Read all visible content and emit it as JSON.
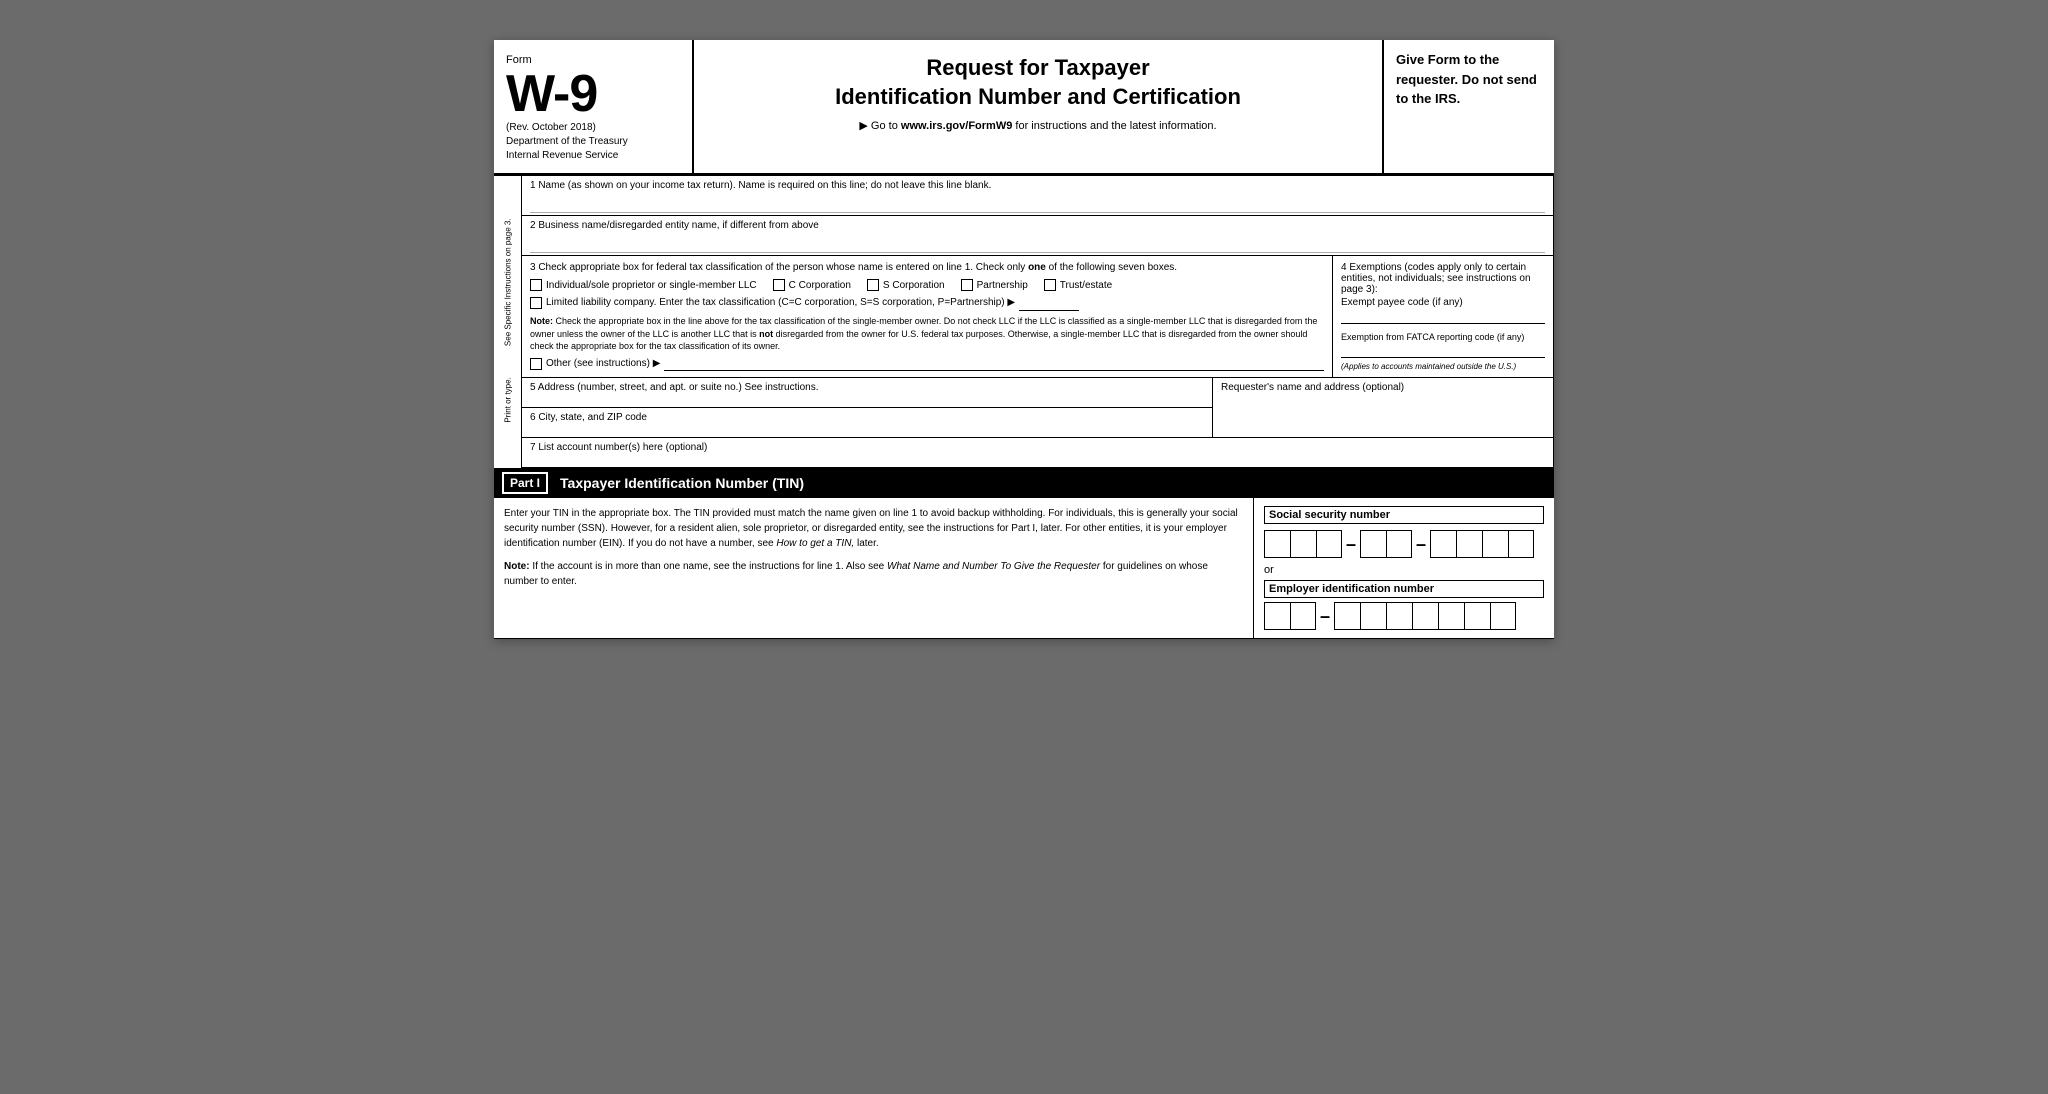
{
  "header": {
    "form_label": "Form",
    "form_number": "W-9",
    "rev": "(Rev. October 2018)",
    "dept1": "Department of the Treasury",
    "dept2": "Internal Revenue Service",
    "title_line1": "Request for Taxpayer",
    "title_line2": "Identification Number and Certification",
    "goto_text": "▶ Go to",
    "goto_url": "www.irs.gov/FormW9",
    "goto_suffix": "for instructions and the latest information.",
    "give_form": "Give Form to the requester. Do not send to the IRS."
  },
  "side_label": {
    "line1": "Print or type.",
    "line2": "See Specific Instructions on page 3."
  },
  "fields": {
    "line1_label": "1  Name (as shown on your income tax return). Name is required on this line; do not leave this line blank.",
    "line2_label": "2  Business name/disregarded entity name, if different from above",
    "line3_header": "3  Check appropriate box for federal tax classification of the person whose name is entered on line 1. Check only",
    "line3_one": "one",
    "line3_header2": "of the following seven boxes.",
    "checkbox_individual": "Individual/sole proprietor or single-member LLC",
    "checkbox_c_corp": "C Corporation",
    "checkbox_s_corp": "S Corporation",
    "checkbox_partnership": "Partnership",
    "checkbox_trust": "Trust/estate",
    "llc_label": "Limited liability company. Enter the tax classification (C=C corporation, S=S corporation, P=Partnership) ▶",
    "note_label": "Note:",
    "note_text": "Check the appropriate box in the line above for the tax classification of the single-member owner.  Do not check LLC if the LLC is classified as a single-member LLC that is disregarded from the owner unless the owner of the LLC is another LLC that is",
    "note_not": "not",
    "note_text2": "disregarded from the owner for U.S. federal tax purposes. Otherwise, a single-member LLC that is disregarded from the owner should check the appropriate box for the tax classification of its owner.",
    "other_label": "Other (see instructions) ▶",
    "exemptions_header": "4  Exemptions (codes apply only to certain entities, not individuals; see instructions on page 3):",
    "exempt_payee_label": "Exempt payee code (if any)",
    "fatca_label": "Exemption from FATCA reporting code (if any)",
    "applies_text": "(Applies to accounts maintained outside the U.S.)",
    "line5_label": "5  Address (number, street, and apt. or suite no.) See instructions.",
    "line6_label": "6  City, state, and ZIP code",
    "requesters_label": "Requester's name and address (optional)",
    "line7_label": "7  List account number(s) here (optional)"
  },
  "part1": {
    "label": "Part I",
    "title": "Taxpayer Identification Number (TIN)",
    "body_text": "Enter your TIN in the appropriate box. The TIN provided must match the name given on line 1 to avoid backup withholding. For individuals, this is generally your social security number (SSN). However, for a resident alien, sole proprietor, or disregarded entity, see the instructions for Part I, later. For other entities, it is your employer identification number (EIN). If you do not have a number, see",
    "how_to_get": "How to get a TIN,",
    "body_text2": "later.",
    "note_label": "Note:",
    "note_body1": "If the account is in more than one name, see the instructions for line 1. Also see",
    "note_italic": "What Name and Number To Give the Requester",
    "note_body2": "for guidelines on whose number to enter.",
    "ssn_label": "Social security number",
    "ssn_group1_count": 3,
    "ssn_group2_count": 2,
    "ssn_group3_count": 4,
    "or_text": "or",
    "ein_label": "Employer identification number",
    "ein_group1_count": 2,
    "ein_group2_count": 7
  }
}
